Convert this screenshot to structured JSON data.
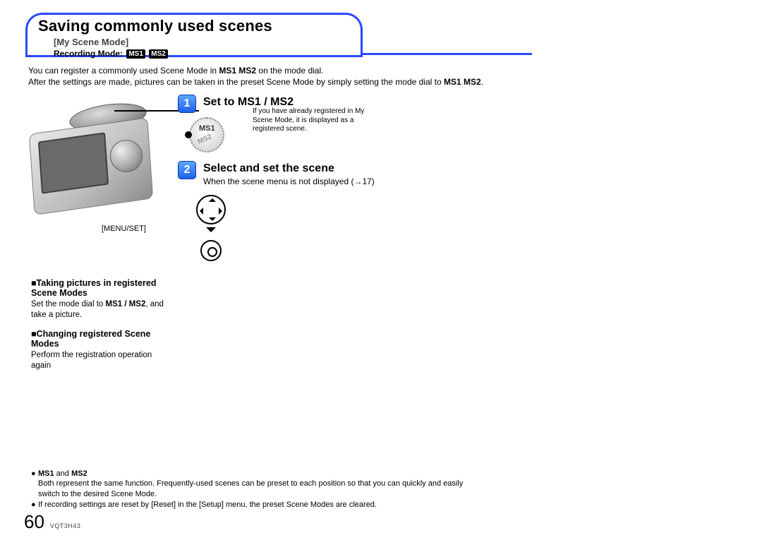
{
  "header": {
    "title": "Saving commonly used scenes",
    "subtitle": "[My Scene Mode]",
    "recording_mode_label": "Recording Mode:",
    "chip1": "MS1",
    "chip2": "MS2"
  },
  "intro": {
    "line1_a": "You can register a commonly used Scene Mode in ",
    "line1_ms": "MS1 MS2",
    "line1_b": " on the mode dial.",
    "line2": "After the settings are made, pictures can be taken in the preset Scene Mode by simply setting the mode dial to ",
    "line2_ms": "MS1 MS2",
    "line2_end": "."
  },
  "steps": {
    "s1": {
      "num": "1",
      "title_a": "Set to ",
      "title_ms": "MS1 / MS2",
      "dial_ms1": "MS1",
      "dial_ms2": "MS2",
      "note": "If you have already registered in My Scene Mode, it is displayed as a registered scene."
    },
    "s2": {
      "num": "2",
      "title": "Select and set the scene",
      "sub": "When the scene menu is not displayed (→17)"
    }
  },
  "camera": {
    "menuset": "[MENU/SET]"
  },
  "leftcol": {
    "h1": "■Taking pictures in registered Scene Modes",
    "b1_a": "Set the mode dial to ",
    "b1_ms": "MS1 / MS2",
    "b1_b": ", and take a picture.",
    "h2": "■Changing registered Scene Modes",
    "b2": "Perform the registration operation again"
  },
  "notes": {
    "n1_ms": "MS1",
    "n1_mid": " and ",
    "n1_ms2": "MS2",
    "n1_body": "Both represent the same function. Frequently-used scenes can be preset to each position so that you can quickly and easily switch to the desired Scene Mode.",
    "n2": "If recording settings are reset by [Reset] in the [Setup] menu, the preset Scene Modes are cleared."
  },
  "footer": {
    "page": "60",
    "code": "VQT3H43"
  }
}
